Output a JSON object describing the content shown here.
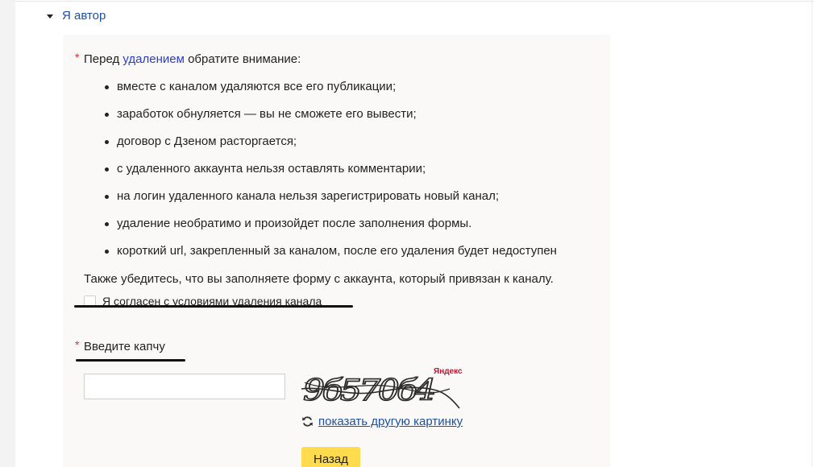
{
  "section": {
    "label": "Я автор"
  },
  "notice": {
    "required_mark": "*",
    "intro_before": "Перед ",
    "intro_link": "удалением",
    "intro_after": " обратите внимание:",
    "bullets": [
      "вместе с каналом удаляются все его публикации;",
      "заработок обнуляется — вы не сможете его вывести;",
      "договор с Дзеном расторгается;",
      "с удаленного аккаунта нельзя оставлять комментарии;",
      "на логин удаленного канала нельзя зарегистрировать новый канал;",
      "удаление необратимо и произойдет после заполнения формы.",
      "короткий url, закрепленный за каналом, после его удаления будет недоступен"
    ],
    "also": "Также убедитесь, что вы заполняете форму с аккаунта, который привязан к каналу."
  },
  "agree": {
    "label": "Я согласен с условиями удаления канала",
    "checked": false
  },
  "captcha": {
    "required_mark": "*",
    "label": "Введите капчу",
    "input_value": "",
    "image_brand": "Яндекс",
    "image_text": "9б570б4",
    "reload_label": "показать другую картинку"
  },
  "actions": {
    "back_label": "Назад"
  },
  "colors": {
    "link": "#1c50a8",
    "inline_link": "#2b3dd1",
    "required": "#e2302b",
    "button": "#ffdb4d",
    "panel": "#faf9f7"
  }
}
